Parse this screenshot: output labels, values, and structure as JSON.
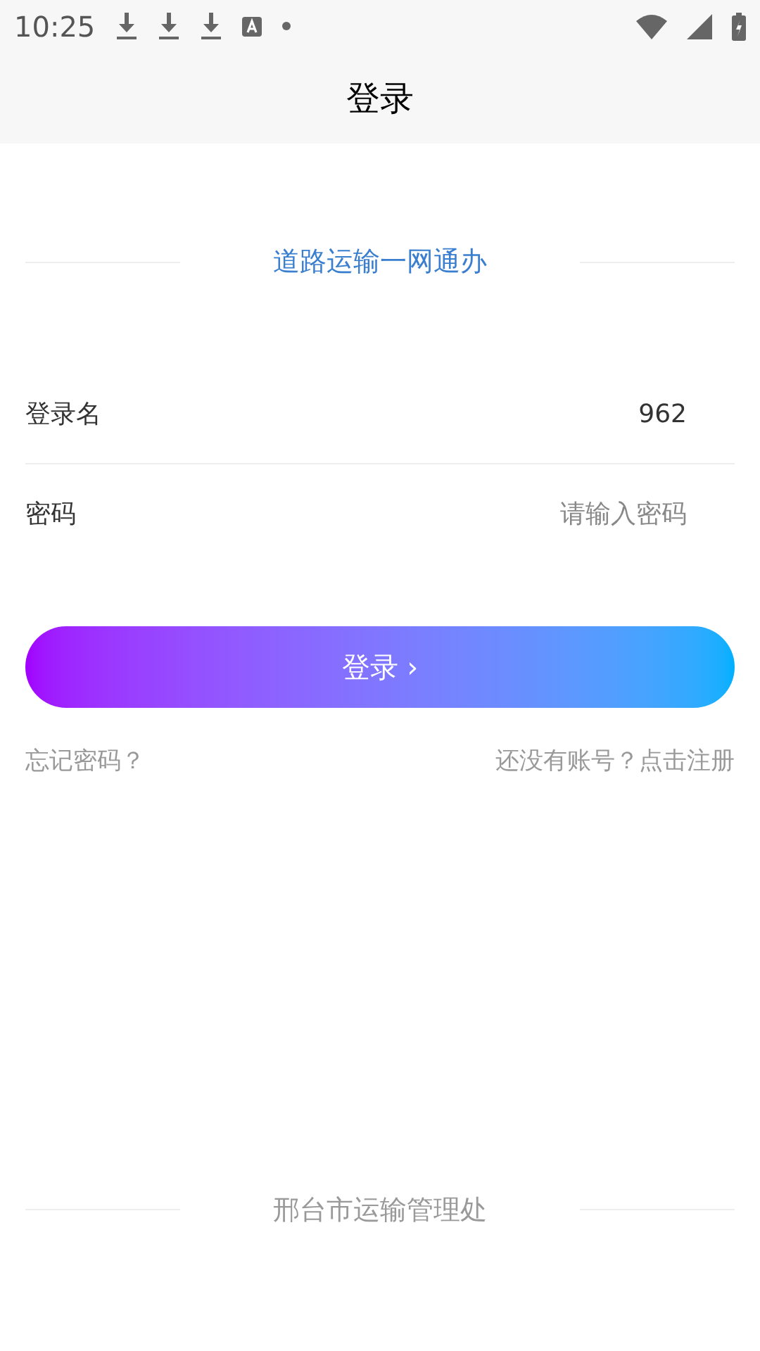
{
  "status_bar": {
    "time": "10:25"
  },
  "header": {
    "title": "登录"
  },
  "section_title": "道路运输一网通办",
  "fields": [
    {
      "label": "登录名",
      "value": "962"
    },
    {
      "label": "密码",
      "placeholder": "请输入密码"
    }
  ],
  "login_button": {
    "label": "登录",
    "arrow": "›"
  },
  "links": {
    "forgot": "忘记密码？",
    "register": "还没有账号？点击注册"
  },
  "footer": "邢台市运输管理处"
}
